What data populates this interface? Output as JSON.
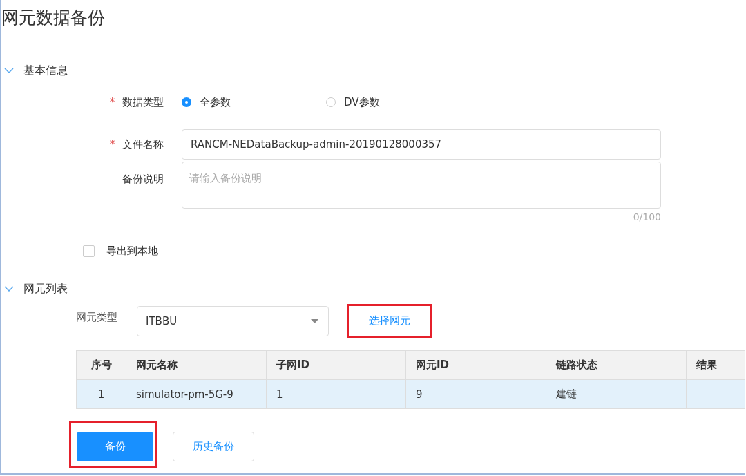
{
  "page": {
    "title": "网元数据备份"
  },
  "basic_section": {
    "title": "基本信息",
    "expanded": true,
    "data_type": {
      "label": "数据类型",
      "required_mark": "*",
      "options": [
        {
          "label": "全参数",
          "selected": true
        },
        {
          "label": "DV参数",
          "selected": false
        }
      ]
    },
    "file_name": {
      "label": "文件名称",
      "required_mark": "*",
      "value": "RANCM-NEDataBackup-admin-20190128000357"
    },
    "description": {
      "label": "备份说明",
      "placeholder": "请输入备份说明",
      "counter": "0/100"
    },
    "export_local": {
      "label": "导出到本地",
      "checked": false
    }
  },
  "ne_section": {
    "title": "网元列表",
    "expanded": true,
    "ne_type": {
      "label": "网元类型",
      "value": "ITBBU"
    },
    "select_button": {
      "label": "选择网元",
      "highlighted": true
    },
    "table": {
      "columns": [
        "序号",
        "网元名称",
        "子网ID",
        "网元ID",
        "链路状态",
        "结果"
      ],
      "rows": [
        {
          "cells": [
            "1",
            "simulator-pm-5G-9",
            "1",
            "9",
            "建链",
            ""
          ],
          "selected": true
        }
      ]
    }
  },
  "buttons": [
    {
      "label": "备份",
      "kind": "primary",
      "highlighted": true
    },
    {
      "label": "历史备份",
      "kind": "default",
      "highlighted": false
    }
  ]
}
